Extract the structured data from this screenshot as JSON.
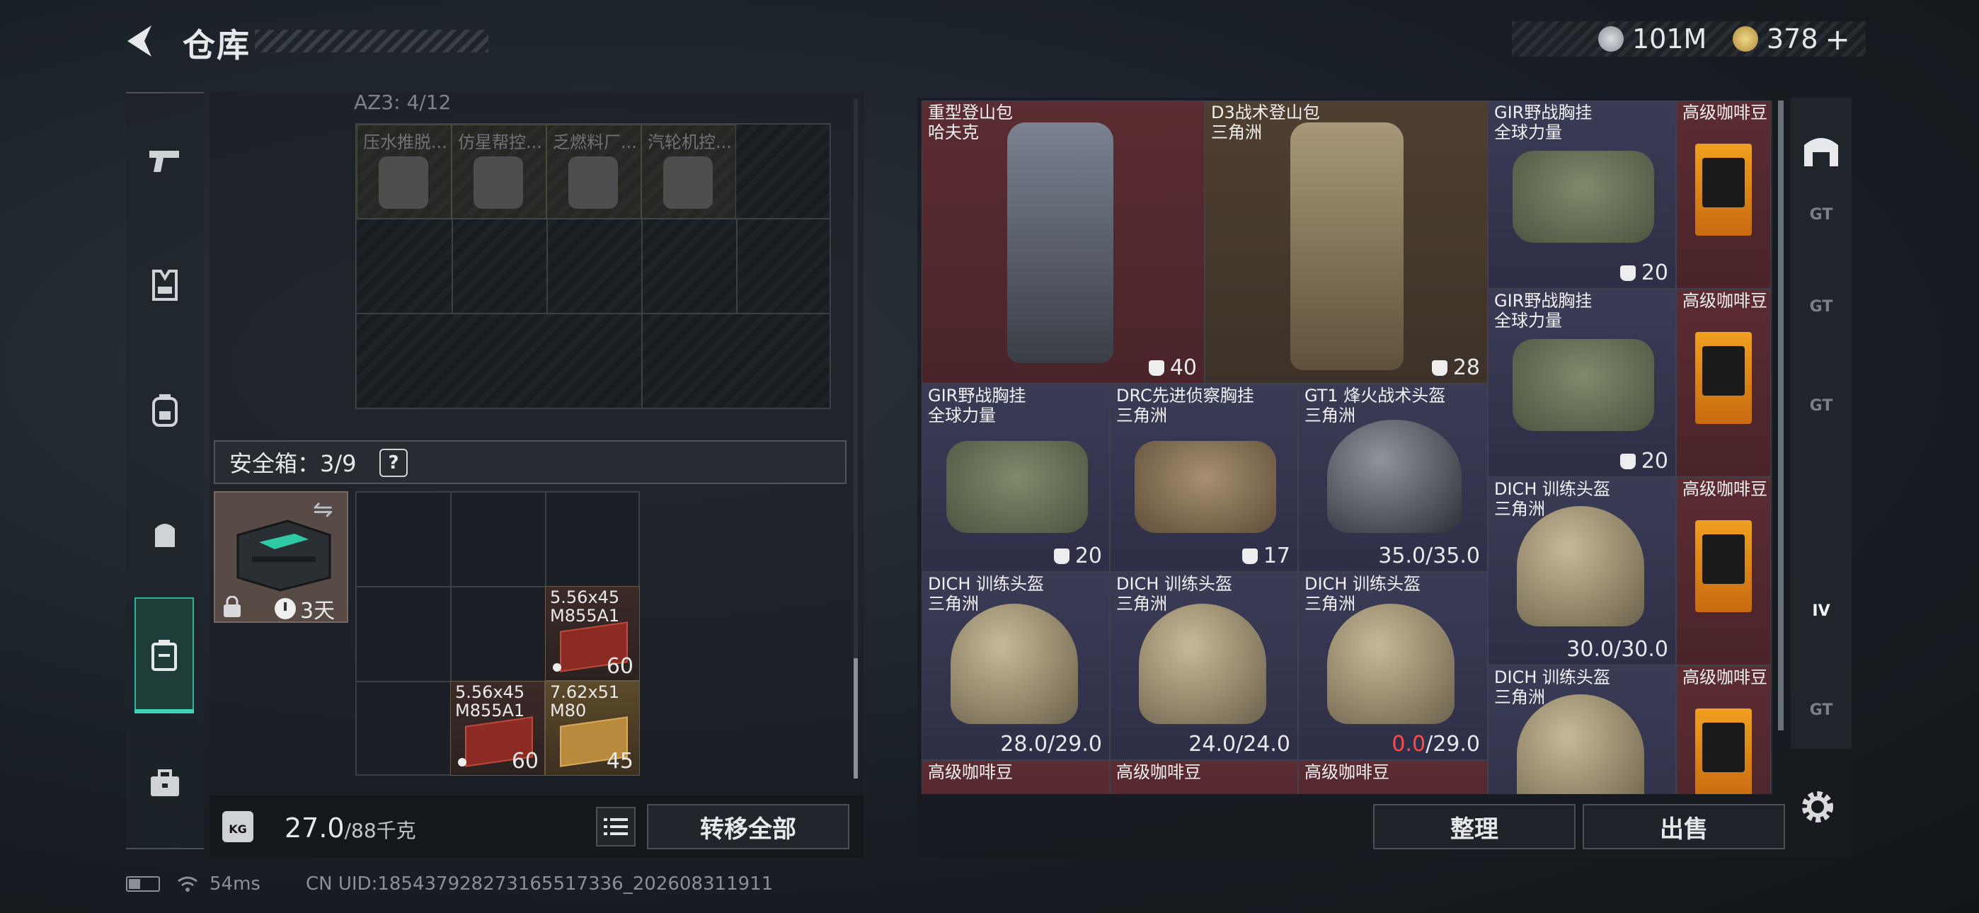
{
  "header": {
    "title": "仓库",
    "currencies": [
      {
        "icon": "silver-coin-icon",
        "value": "101M"
      },
      {
        "icon": "gold-coin-icon",
        "value": "378"
      }
    ],
    "add_symbol": "+"
  },
  "nav": {
    "items": [
      {
        "icon": "pistol-icon",
        "active": false
      },
      {
        "icon": "vest-icon",
        "active": false
      },
      {
        "icon": "backpack-icon",
        "active": false
      },
      {
        "icon": "pouch-icon",
        "active": false
      },
      {
        "icon": "safebox-icon",
        "active": true
      },
      {
        "icon": "briefcase-icon",
        "active": false
      }
    ]
  },
  "storage": {
    "container_label": "AZ3: 4/12",
    "ghost_items": [
      "压水推脱...",
      "仿星帮控...",
      "乏燃料厂...",
      "汽轮机控..."
    ]
  },
  "safebox": {
    "label": "安全箱：3/9",
    "help": "?",
    "timer": "3天",
    "items": [
      {
        "name": "5.56x45\nM855A1",
        "count": "60",
        "style": "red"
      },
      {
        "name": "5.56x45\nM855A1",
        "count": "60",
        "style": "red"
      },
      {
        "name": "7.62x51\nM80",
        "count": "45",
        "style": "tan"
      }
    ]
  },
  "footer": {
    "weight": "27.0",
    "capacity": "/88千克",
    "kg_label": "KG",
    "transfer_all": "转移全部"
  },
  "inventory": {
    "items": [
      {
        "name": "重型登山包\n哈夫克",
        "value": "40",
        "rarity": "red"
      },
      {
        "name": "D3战术登山包\n三角洲",
        "value": "28",
        "rarity": "gold"
      },
      {
        "name": "GIR野战胸挂\n全球力量",
        "value": "20",
        "rarity": "purple"
      },
      {
        "name": "高级咖啡豆",
        "value": "",
        "rarity": "red"
      },
      {
        "name": "GIR野战胸挂\n全球力量",
        "value": "20",
        "rarity": "purple"
      },
      {
        "name": "高级咖啡豆",
        "value": "",
        "rarity": "red"
      },
      {
        "name": "GIR野战胸挂\n全球力量",
        "value": "20",
        "rarity": "purple"
      },
      {
        "name": "DRC先进侦察胸挂\n三角洲",
        "value": "17",
        "rarity": "purple"
      },
      {
        "name": "GT1 烽火战术头盔\n三角洲",
        "value": "35.0/35.0",
        "rarity": "purple"
      },
      {
        "name": "DICH 训练头盔\n三角洲",
        "value": "30.0/30.0",
        "rarity": "purple"
      },
      {
        "name": "高级咖啡豆",
        "value": "",
        "rarity": "red"
      },
      {
        "name": "DICH 训练头盔\n三角洲",
        "value": "28.0/29.0",
        "rarity": "purple"
      },
      {
        "name": "DICH 训练头盔\n三角洲",
        "value": "24.0/24.0",
        "rarity": "purple"
      },
      {
        "name": "DICH 训练头盔\n三角洲",
        "value_red": "0.0",
        "value_rest": "/29.0",
        "rarity": "purple"
      },
      {
        "name": "DICH 训练头盔\n三角洲",
        "value": "",
        "rarity": "purple"
      },
      {
        "name": "高级咖啡豆",
        "value": "",
        "rarity": "red"
      },
      {
        "name": "高级咖啡豆",
        "value": "",
        "rarity": "red"
      },
      {
        "name": "高级咖啡豆",
        "value": "",
        "rarity": "red"
      },
      {
        "name": "高级咖啡豆",
        "value": "",
        "rarity": "red"
      }
    ]
  },
  "side_tabs": [
    "GT",
    "GT",
    "GT",
    "IV",
    "GT"
  ],
  "actions": {
    "sort": "整理",
    "sell": "出售"
  },
  "status": {
    "ping": "54ms",
    "uid": "CN UID:1854379282731655173​36_202608311911"
  },
  "colors": {
    "accent": "#3ad6b5",
    "rarity_red": "#5b2c31",
    "rarity_purple": "#3a3b55",
    "rarity_gold": "#4e3f31"
  }
}
